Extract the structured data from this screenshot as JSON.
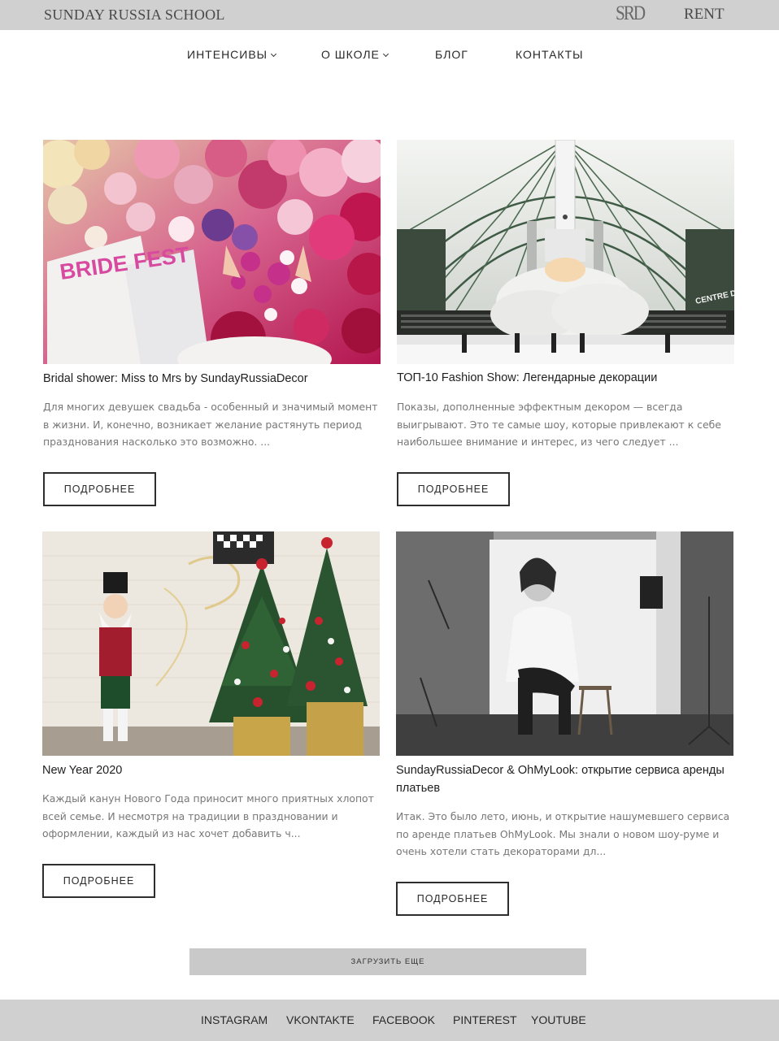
{
  "header": {
    "brand": "SUNDAY RUSSIA SCHOOL",
    "logo": "SRD",
    "rent": "RENT"
  },
  "nav": [
    {
      "label": "ИНТЕНСИВЫ",
      "icon": "chevron-down-icon"
    },
    {
      "label": "О ШКОЛЕ",
      "icon": "chevron-down-icon"
    },
    {
      "label": "БЛОГ"
    },
    {
      "label": "КОНТАКТЫ"
    }
  ],
  "posts": [
    {
      "title": "Bridal shower: Miss to Mrs by SundayRussiaDecor",
      "excerpt": "Для многих девушек свадьба - особенный и значимый момент в жизни. И, конечно, возникает желание растянуть период празднования насколько это возможно. ...",
      "image_text": "BRIDE FEST",
      "button": "ПОДРОБНЕЕ"
    },
    {
      "title": "ТОП-10 Fashion Show: Легендарные декорации",
      "excerpt": "Показы, дополненные эффектным декором — всегда выигрывают. Это те самые шоу, которые привлекают к себе наибольшее внимание и интерес, из чего следует ...",
      "image_text": "CENTRE DE",
      "button": "ПОДРОБНЕЕ"
    },
    {
      "title": "New Year 2020",
      "excerpt": "Каждый канун Нового Года приносит много приятных хлопот всей семье. И несмотря на традиции в праздновании и оформлении, каждый из нас хочет добавить ч...",
      "button": "ПОДРОБНЕЕ"
    },
    {
      "title": "SundayRussiaDecor & OhMyLook: открытие сервиса аренды платьев",
      "excerpt": "Итак. Это было лето, июнь, и открытие нашумевшего сервиса по аренде платьев OhMyLook. Мы знали о новом шоу-руме и очень хотели стать декораторами дл...",
      "button": "ПОДРОБНЕЕ"
    }
  ],
  "load_more": "ЗАГРУЗИТЬ ЕЩЕ",
  "footer": {
    "links": [
      "INSTAGRAM",
      "VKONTAKTE",
      "FACEBOOK",
      "PINTEREST",
      "YOUTUBE"
    ]
  },
  "colors": {
    "topbar": "#d0d0d0",
    "footer": "#d0d0d0",
    "load_more_bg": "#c9c9c9",
    "text": "#2a2a2a",
    "excerpt": "#777777"
  }
}
